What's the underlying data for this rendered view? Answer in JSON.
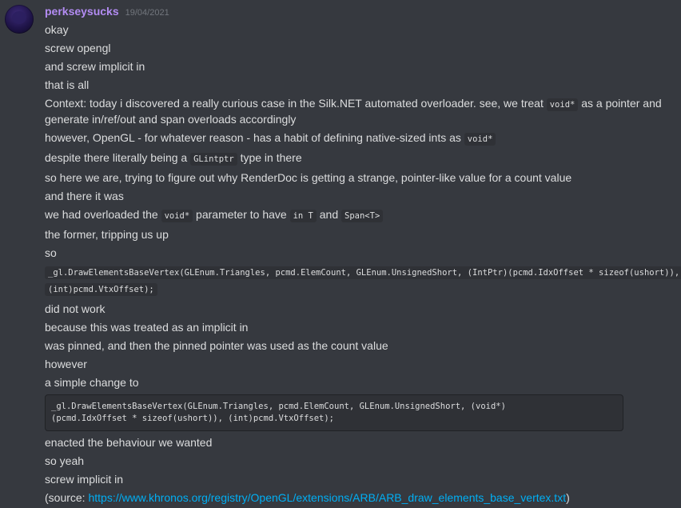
{
  "author": {
    "name": "perkseysucks",
    "timestamp": "19/04/2021"
  },
  "messages": {
    "m1": "okay",
    "m2": "screw opengl",
    "m3": "and screw implicit in",
    "m4": "that is all",
    "m5": {
      "t1": "Context: today i discovered a really curious case in the Silk.NET automated overloader. see, we treat ",
      "c1": "void*",
      "t2": " as a pointer and generate in/ref/out and span overloads accordingly"
    },
    "m6": {
      "t1": "however, OpenGL - for whatever reason - has a habit of defining native-sized ints as ",
      "c1": "void*"
    },
    "m7": {
      "t1": "despite there literally being a ",
      "c1": "GLintptr",
      "t2": " type in there"
    },
    "m8": "so here we are, trying to figure out why RenderDoc is getting a strange, pointer-like value for a count value",
    "m9": "and there it was",
    "m10": {
      "t1": "we had overloaded the ",
      "c1": "void*",
      "t2": " parameter to have ",
      "c2": "in T",
      "t3": " and ",
      "c3": "Span<T>"
    },
    "m11": "the former, tripping us up",
    "m12": "so",
    "m13_code": "_gl.DrawElementsBaseVertex(GLEnum.Triangles, pcmd.ElemCount, GLEnum.UnsignedShort, (IntPtr)(pcmd.IdxOffset * sizeof(ushort)), (int)pcmd.VtxOffset);",
    "m14": "did not work",
    "m15": "because this was treated as an implicit in",
    "m16": "was pinned, and then the pinned pointer was used as the count value",
    "m17": "however",
    "m18": "a simple change to",
    "m19_codeblock": "_gl.DrawElementsBaseVertex(GLEnum.Triangles, pcmd.ElemCount, GLEnum.UnsignedShort, (void*)\n(pcmd.IdxOffset * sizeof(ushort)), (int)pcmd.VtxOffset);",
    "m20": "enacted the behaviour we wanted",
    "m21": "so yeah",
    "m22": "screw implicit in",
    "m23": {
      "t1": "(source: ",
      "link": "https://www.khronos.org/registry/OpenGL/extensions/ARB/ARB_draw_elements_base_vertex.txt",
      "t2": ")"
    }
  },
  "colors": {
    "background": "#36393f",
    "username": "#b38cf3",
    "link": "#00aff4",
    "code_bg": "#2f3136"
  }
}
